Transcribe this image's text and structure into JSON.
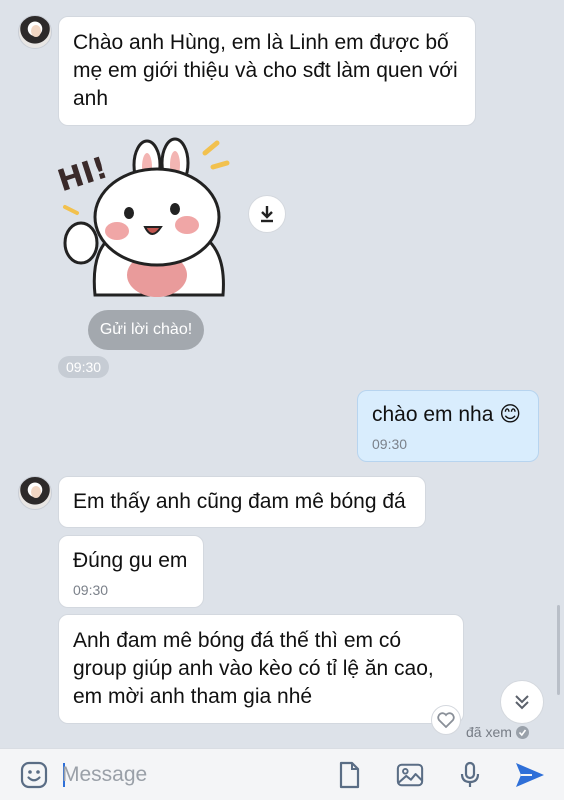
{
  "messages": {
    "intro": "Chào anh Hùng, em là Linh em được bố mẹ em giới thiệu và cho sđt làm quen với anh",
    "greet_button": "Gửi lời chào!",
    "greet_time": "09:30",
    "reply": "chào em nha 😊",
    "reply_time": "09:30",
    "football": "Em thấy anh cũng đam mê bóng đá",
    "taste": "Đúng gu em",
    "taste_time": "09:30",
    "invite": "Anh đam mê bóng đá thế thì em có group giúp anh vào kèo có tỉ lệ ăn cao, em mời anh tham gia nhé"
  },
  "sticker": {
    "text": "HI!"
  },
  "status": {
    "seen": "đã xem"
  },
  "composer": {
    "placeholder": "Message"
  },
  "icons": {
    "emoji": "emoji-icon",
    "file": "file-icon",
    "image": "image-icon",
    "mic": "microphone-icon",
    "send": "send-icon",
    "download": "download-icon",
    "heart": "heart-icon",
    "jump": "chevrons-down-icon"
  },
  "colors": {
    "accent": "#2e6fd8",
    "my_bubble": "#d9edfd",
    "background": "#dde2e9"
  }
}
